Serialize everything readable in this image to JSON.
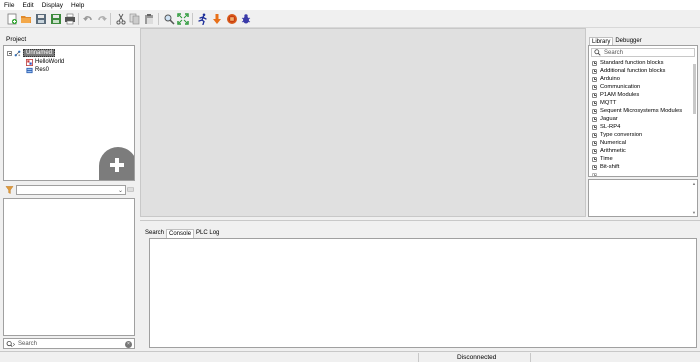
{
  "menu": [
    "File",
    "Edit",
    "Display",
    "Help"
  ],
  "toolbar": {
    "icons": [
      "new-icon",
      "open-icon",
      "save-icon",
      "save-as-icon",
      "print-icon",
      "undo-icon",
      "redo-icon",
      "cut-icon",
      "copy-icon",
      "paste-icon",
      "find-icon",
      "fullscreen-icon",
      "run-icon",
      "download-icon",
      "stop-icon",
      "debug-icon"
    ]
  },
  "project": {
    "label": "Project",
    "root": "Unnamed",
    "items": [
      "HelloWorld",
      "Res0"
    ]
  },
  "left_search": {
    "placeholder": "Search"
  },
  "library": {
    "tabs": [
      "Library",
      "Debugger"
    ],
    "search_placeholder": "Search",
    "items": [
      "Standard function blocks",
      "Additional function blocks",
      "Arduino",
      "Communication",
      "P1AM Modules",
      "MQTT",
      "Sequent Microsystems Modules",
      "Jaguar",
      "SL-RP4",
      "Type conversion",
      "Numerical",
      "Arithmetic",
      "Time",
      "Bit-shift"
    ]
  },
  "console": {
    "tabs": [
      "Search",
      "Console",
      "PLC Log"
    ]
  },
  "status": {
    "connection": "Disconnected"
  }
}
